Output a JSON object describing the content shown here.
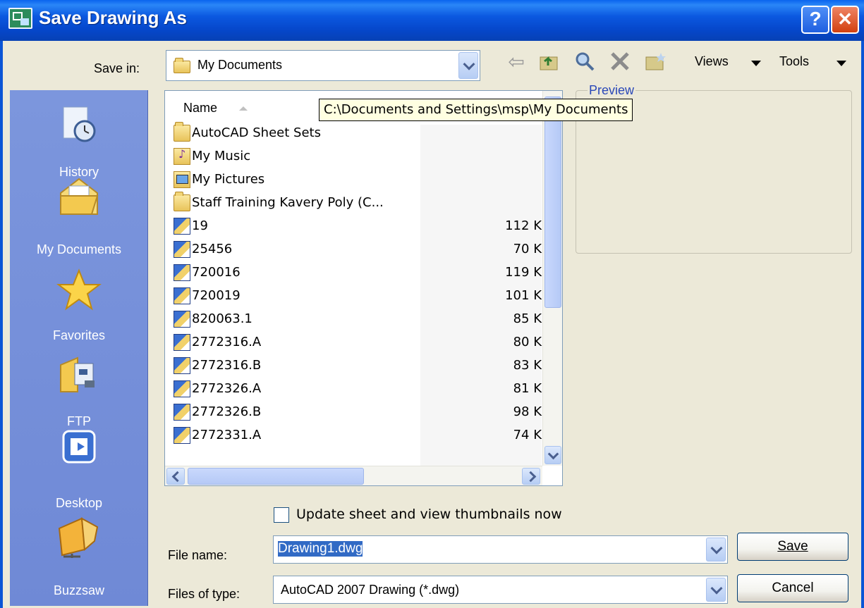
{
  "window": {
    "title": "Save Drawing As",
    "help_glyph": "?",
    "close_glyph": "✕"
  },
  "toolbar": {
    "save_in_label": "Save in:",
    "save_in_value": "My Documents",
    "views_label": "Views",
    "tools_label": "Tools"
  },
  "places": [
    {
      "label": "History",
      "icon": "history-icon"
    },
    {
      "label": "My Documents",
      "icon": "my-documents-icon"
    },
    {
      "label": "Favorites",
      "icon": "favorites-icon"
    },
    {
      "label": "FTP",
      "icon": "ftp-icon"
    },
    {
      "label": "Desktop",
      "icon": "desktop-icon"
    },
    {
      "label": "Buzzsaw",
      "icon": "buzzsaw-icon"
    }
  ],
  "file_list": {
    "column_name": "Name",
    "rows": [
      {
        "name": "AutoCAD Sheet Sets",
        "size": "",
        "icon": "folder-icon"
      },
      {
        "name": "My Music",
        "size": "",
        "icon": "music-folder-icon"
      },
      {
        "name": "My Pictures",
        "size": "",
        "icon": "pictures-folder-icon"
      },
      {
        "name": "Staff Training Kavery Poly (C...",
        "size": "",
        "icon": "folder-icon"
      },
      {
        "name": "19",
        "size": "112 K",
        "icon": "drawing-file-icon"
      },
      {
        "name": "25456",
        "size": "70 K",
        "icon": "drawing-file-icon"
      },
      {
        "name": "720016",
        "size": "119 K",
        "icon": "drawing-file-icon"
      },
      {
        "name": "720019",
        "size": "101 K",
        "icon": "drawing-file-icon"
      },
      {
        "name": "820063.1",
        "size": "85 K",
        "icon": "drawing-file-icon"
      },
      {
        "name": "2772316.A",
        "size": "80 K",
        "icon": "drawing-file-icon"
      },
      {
        "name": "2772316.B",
        "size": "83 K",
        "icon": "drawing-file-icon"
      },
      {
        "name": "2772326.A",
        "size": "81 K",
        "icon": "drawing-file-icon"
      },
      {
        "name": "2772326.B",
        "size": "98 K",
        "icon": "drawing-file-icon"
      },
      {
        "name": "2772331.A",
        "size": "74 K",
        "icon": "drawing-file-icon"
      }
    ]
  },
  "tooltip": "C:\\Documents and Settings\\msp\\My Documents",
  "preview_label": "Preview",
  "thumbnails_checkbox": {
    "label": "Update sheet and view thumbnails now",
    "checked": false
  },
  "file_name": {
    "label": "File name:",
    "value": "Drawing1.dwg"
  },
  "file_type": {
    "label": "Files of type:",
    "value": "AutoCAD 2007 Drawing (*.dwg)"
  },
  "buttons": {
    "save": "Save",
    "cancel": "Cancel"
  },
  "colors": {
    "title_bar": "#0b58e0",
    "places_bar": "#7c96dd",
    "dialog_bg": "#ece9d8",
    "selection": "#316ac5"
  }
}
